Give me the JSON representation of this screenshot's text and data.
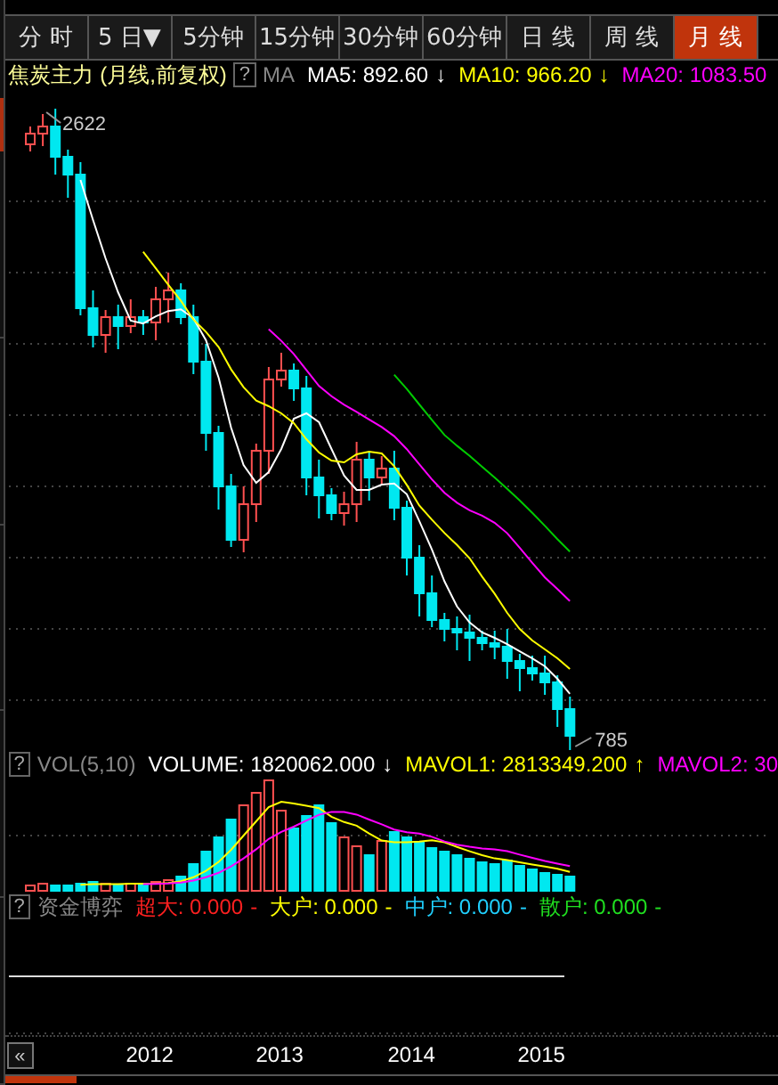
{
  "period_tabs": [
    {
      "label": "分 时",
      "selected": false
    },
    {
      "label": "5 日▼",
      "selected": false
    },
    {
      "label": "5分钟",
      "selected": false
    },
    {
      "label": "15分钟",
      "selected": false
    },
    {
      "label": "30分钟",
      "selected": false
    },
    {
      "label": "60分钟",
      "selected": false
    },
    {
      "label": "日 线",
      "selected": false
    },
    {
      "label": "周 线",
      "selected": false
    },
    {
      "label": "月 线",
      "selected": true
    }
  ],
  "price_panel": {
    "title": "焦炭主力 (月线,前复权)",
    "help": "?",
    "indicator": "MA",
    "values": [
      {
        "label": "MA5: 892.60",
        "arrow": "↓",
        "color": "#ffffff"
      },
      {
        "label": "MA10: 966.20",
        "arrow": "↓",
        "color": "#ffff00"
      },
      {
        "label": "MA20: 1083.50",
        "color": "#ff00ff"
      }
    ],
    "high_label": "2622",
    "low_label": "785"
  },
  "volume_panel": {
    "help": "?",
    "indicator": "VOL(5,10)",
    "values": [
      {
        "label": "VOLUME: 1820062.000",
        "arrow": "↓",
        "color": "#ffffff"
      },
      {
        "label": "MAVOL1: 2813349.200",
        "arrow": "↑",
        "color": "#ffff00"
      },
      {
        "label": "MAVOL2: 30",
        "color": "#ff00ff"
      }
    ]
  },
  "fund_panel": {
    "help": "?",
    "indicator": "资金博弈",
    "values": [
      {
        "label": "超大: 0.000",
        "dash": "-",
        "color": "#ff2020"
      },
      {
        "label": "大户: 0.000",
        "dash": "-",
        "color": "#ffff00"
      },
      {
        "label": "中户: 0.000",
        "dash": "-",
        "color": "#20d0ff"
      },
      {
        "label": "散户: 0.000",
        "dash": "-",
        "color": "#20e020"
      }
    ]
  },
  "time_axis": {
    "scroll_button": "«",
    "years": [
      "2012",
      "2013",
      "2014",
      "2015"
    ]
  }
}
